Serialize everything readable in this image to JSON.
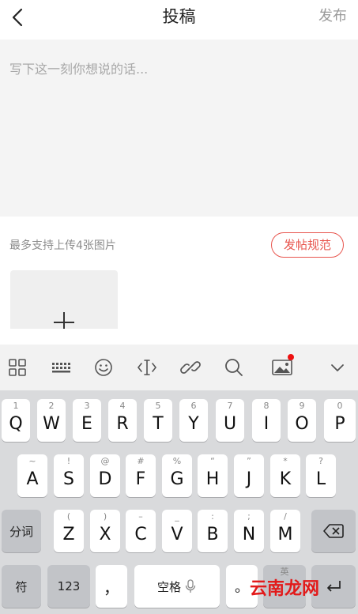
{
  "header": {
    "title": "投稿",
    "publish_label": "发布"
  },
  "editor": {
    "placeholder": "写下这一刻你想说的话..."
  },
  "upload": {
    "hint": "最多支持上传4张图片",
    "rules_label": "发帖规范"
  },
  "toolbar": {
    "icons": [
      "grid-icon",
      "keyboard-icon",
      "emoji-icon",
      "cursor-icon",
      "link-icon",
      "search-icon",
      "image-icon",
      "collapse-chevron-icon"
    ]
  },
  "keyboard": {
    "row1": [
      {
        "key": "Q",
        "sub": "1"
      },
      {
        "key": "W",
        "sub": "2"
      },
      {
        "key": "E",
        "sub": "3"
      },
      {
        "key": "R",
        "sub": "4"
      },
      {
        "key": "T",
        "sub": "5"
      },
      {
        "key": "Y",
        "sub": "6"
      },
      {
        "key": "U",
        "sub": "7"
      },
      {
        "key": "I",
        "sub": "8"
      },
      {
        "key": "O",
        "sub": "9"
      },
      {
        "key": "P",
        "sub": "0"
      }
    ],
    "row2": [
      {
        "key": "A",
        "sub": "~"
      },
      {
        "key": "S",
        "sub": "!"
      },
      {
        "key": "D",
        "sub": "@"
      },
      {
        "key": "F",
        "sub": "#"
      },
      {
        "key": "G",
        "sub": "%"
      },
      {
        "key": "H",
        "sub": "“"
      },
      {
        "key": "J",
        "sub": "”"
      },
      {
        "key": "K",
        "sub": "*"
      },
      {
        "key": "L",
        "sub": "?"
      }
    ],
    "row3": [
      {
        "key": "Z",
        "sub": "("
      },
      {
        "key": "X",
        "sub": ")"
      },
      {
        "key": "C",
        "sub": "–"
      },
      {
        "key": "V",
        "sub": "_"
      },
      {
        "key": "B",
        "sub": ":"
      },
      {
        "key": "N",
        "sub": ";"
      },
      {
        "key": "M",
        "sub": "/"
      }
    ],
    "fenci_label": "分词",
    "fu_label": "符",
    "num_label": "123",
    "comma_label": "，",
    "space_label": "空格",
    "period_label": "。",
    "lang_hint": "英"
  },
  "watermark": {
    "text": "云南龙网"
  },
  "colors": {
    "accent": "#e8554e",
    "keyboard_bg": "#d9dadc",
    "key_bg": "#ffffff",
    "key_dark_bg": "#c2c4c8"
  }
}
